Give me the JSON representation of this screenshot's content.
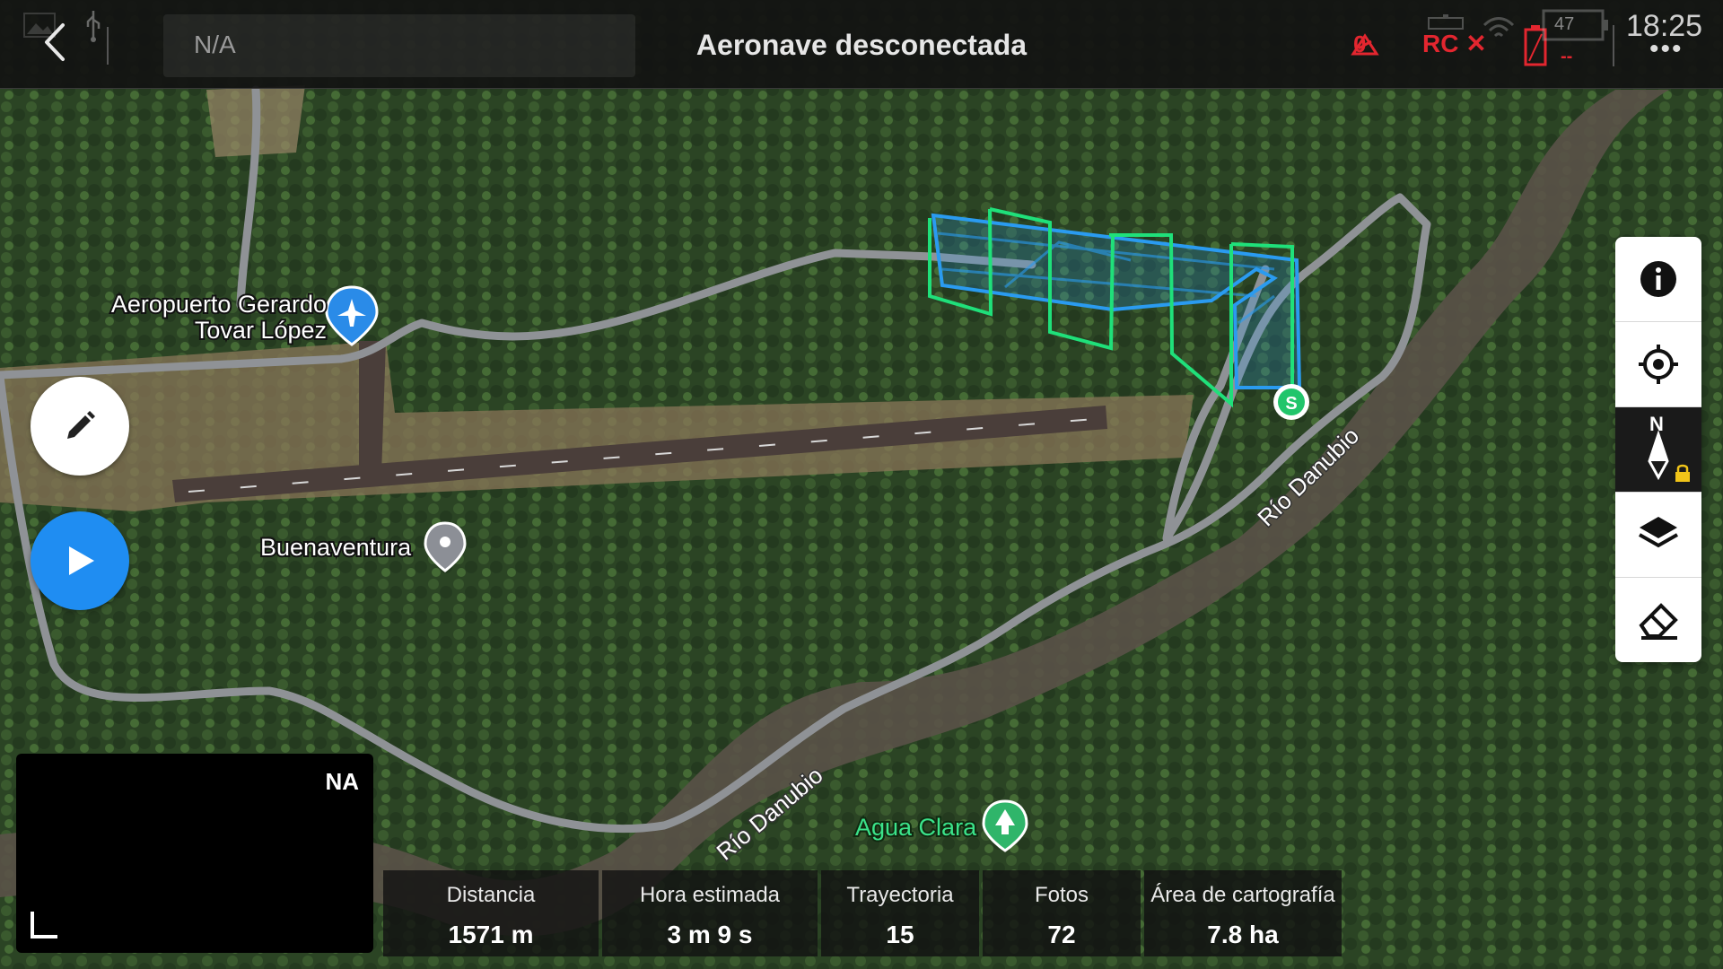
{
  "header": {
    "search_text": "N/A",
    "status_title": "Aeronave desconectada",
    "drone_count": "0",
    "rc_label": "RC ✕",
    "battery_percent": "47",
    "battery_status": "--",
    "clock": "18:25",
    "more": "•••"
  },
  "map": {
    "labels": {
      "airport_line1": "Aeropuerto Gerardo",
      "airport_line2": "Tovar López",
      "town": "Buenaventura",
      "river1": "Río Danubio",
      "river2": "Río Danubio",
      "park": "Agua Clara"
    },
    "start_marker": "S",
    "colors": {
      "flight_path": "#2a9bf0",
      "survey_area": "#1fe07a",
      "road": "#9a9a9a",
      "start_marker": "#21c56b"
    }
  },
  "left_buttons": {
    "edit_icon": "pencil-icon",
    "play_icon": "play-icon"
  },
  "toolbar": {
    "items": [
      "info-icon",
      "locate-icon",
      "compass-icon",
      "layers-icon",
      "eraser-icon"
    ],
    "compass_label": "N"
  },
  "camera": {
    "label": "NA"
  },
  "stats": [
    {
      "label": "Distancia",
      "value": "1571 m"
    },
    {
      "label": "Hora estimada",
      "value": "3 m 9 s"
    },
    {
      "label": "Trayectoria",
      "value": "15"
    },
    {
      "label": "Fotos",
      "value": "72"
    },
    {
      "label": "Área de cartografía",
      "value": "7.8 ha"
    }
  ]
}
